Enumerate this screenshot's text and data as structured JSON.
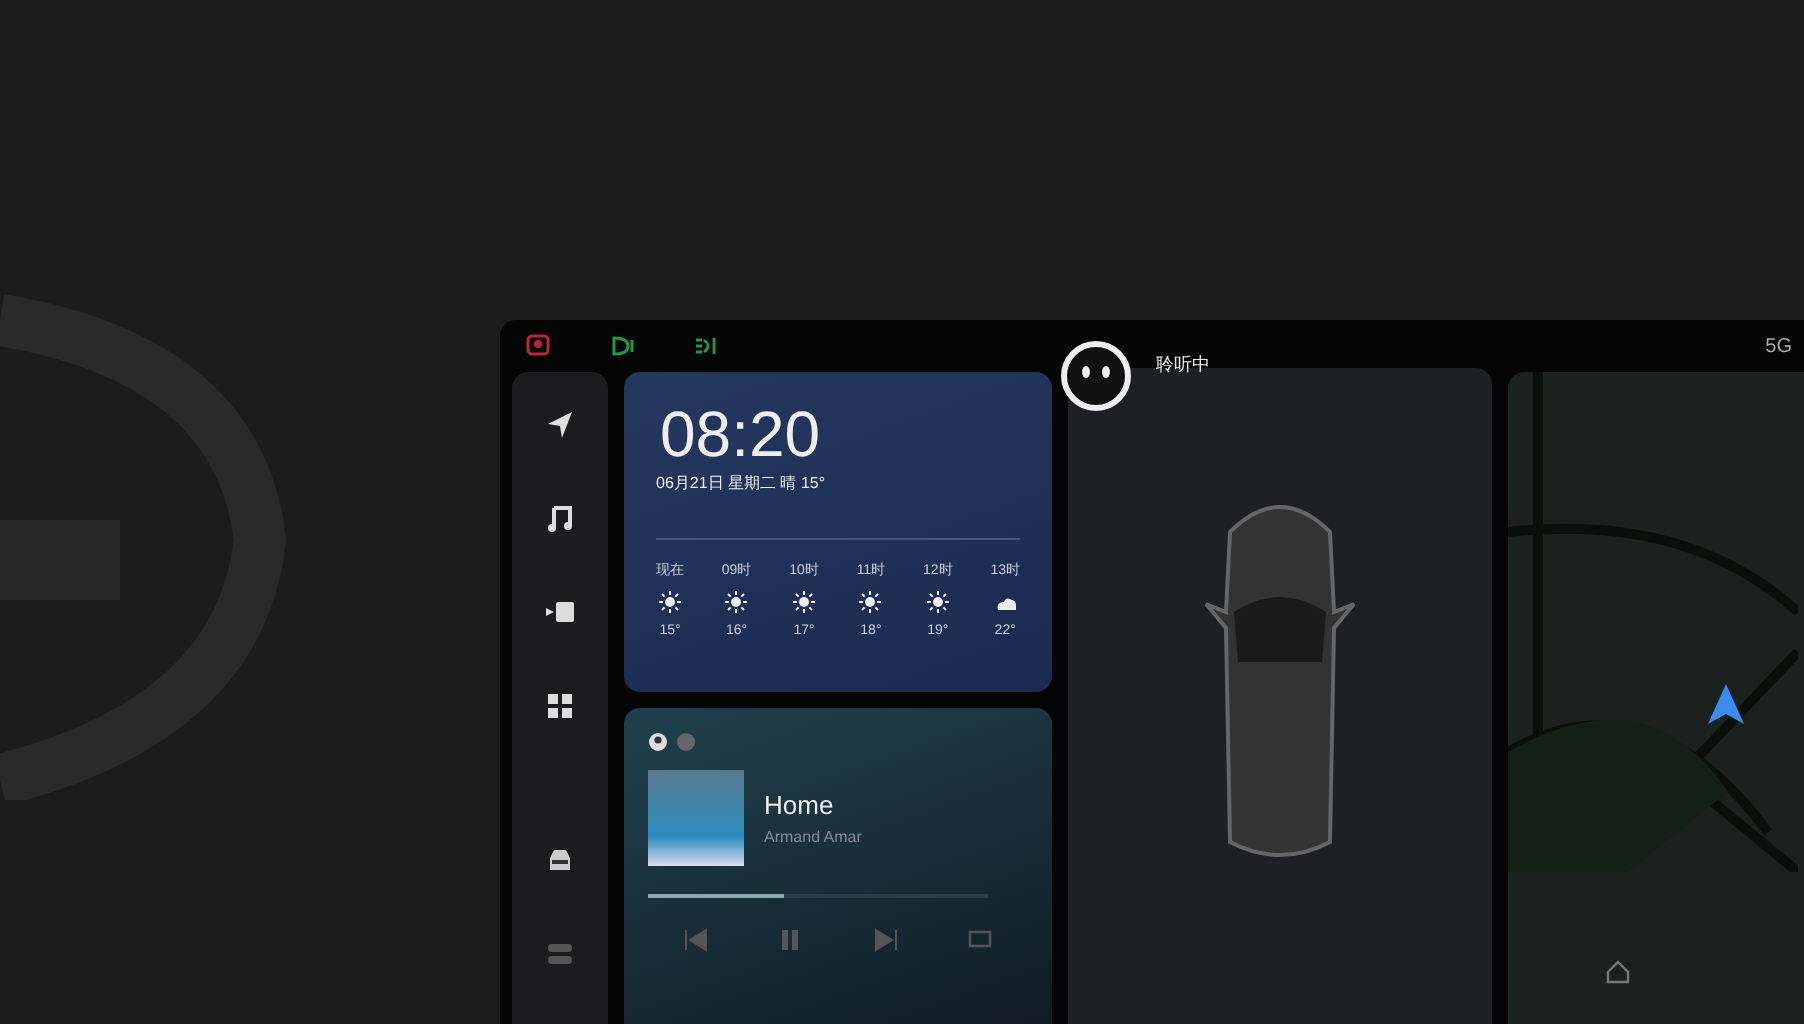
{
  "status_bar": {
    "indicators": [
      {
        "kind": "seat",
        "color": "#b8263a"
      },
      {
        "kind": "lamp",
        "color": "#1f9a4a"
      },
      {
        "kind": "beam",
        "color": "#1f9a4a"
      }
    ],
    "network": "5G"
  },
  "sidebar": {
    "items": [
      {
        "kind": "navigate"
      },
      {
        "kind": "music"
      },
      {
        "kind": "video"
      },
      {
        "kind": "apps"
      },
      {
        "kind": "car"
      },
      {
        "kind": "toggles"
      }
    ]
  },
  "weather": {
    "time": "08:20",
    "date_line": "06月21日 星期二 晴 15°",
    "forecast": [
      {
        "hour": "现在",
        "kind": "sun",
        "temp": "15°"
      },
      {
        "hour": "09时",
        "kind": "sun",
        "temp": "16°"
      },
      {
        "hour": "10时",
        "kind": "sun",
        "temp": "17°"
      },
      {
        "hour": "11时",
        "kind": "sun",
        "temp": "18°"
      },
      {
        "hour": "12时",
        "kind": "sun",
        "temp": "19°"
      },
      {
        "hour": "13时",
        "kind": "cloud",
        "temp": "22°"
      }
    ]
  },
  "music": {
    "title": "Home",
    "artist": "Armand Amar",
    "progress": {
      "level": 0.4
    },
    "controls": [
      {
        "kind": "previous"
      },
      {
        "kind": "pause"
      },
      {
        "kind": "next"
      },
      {
        "kind": "screen"
      }
    ]
  },
  "assistant": {
    "status": "聆听中"
  },
  "map": {
    "home": true
  }
}
